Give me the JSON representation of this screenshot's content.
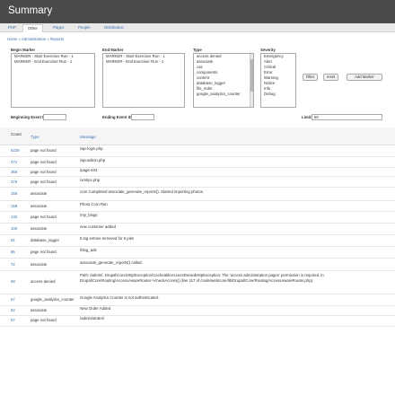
{
  "page": {
    "title": "Summary"
  },
  "tabs": [
    {
      "label": "PHP"
    },
    {
      "label": "Other"
    },
    {
      "label": "Pages"
    },
    {
      "label": "People"
    },
    {
      "label": "Distribution"
    }
  ],
  "breadcrumb": "Home » Administration » Reports",
  "filters": {
    "begin_marker": {
      "label": "Begin Marker",
      "options": [
        "MARKER - Start Exerciser Run - 1",
        "MARKER - End Exerciser Run - 1"
      ]
    },
    "end_marker": {
      "label": "End Marker",
      "options": [
        "MARKER - Start Exerciser Run - 1",
        "MARKER - End Exerciser Run - 1"
      ]
    },
    "type": {
      "label": "Type",
      "options": [
        "access denied",
        "associate",
        "cas",
        "components",
        "content",
        "database_logger",
        "file_mdm",
        "google_analytics_counter"
      ]
    },
    "severity": {
      "label": "Severity",
      "options": [
        "Emergency",
        "Alert",
        "Critical",
        "Error",
        "Warning",
        "Notice",
        "Info",
        "Debug"
      ]
    },
    "filter_button": "Filter",
    "reset_button": "reset",
    "add_marker_button": "Add Marker",
    "beginning_event_id": {
      "label": "Beginning Event ID",
      "value": ""
    },
    "ending_event_id": {
      "label": "Ending Event ID",
      "value": ""
    },
    "limit": {
      "label": "Limit:",
      "value": "50"
    }
  },
  "table": {
    "headers": {
      "count": "Count",
      "type": "Type",
      "message": "Message"
    },
    "rows": [
      {
        "count": "6229",
        "type": "page not found",
        "message": "/wp-login.php"
      },
      {
        "count": "371",
        "type": "page not found",
        "message": "/wp-admin.php"
      },
      {
        "count": "365",
        "type": "page not found",
        "message": "/page-404"
      },
      {
        "count": "279",
        "type": "page not found",
        "message": "/xmlrpc.php"
      },
      {
        "count": "158",
        "type": "associate",
        "message": "cron Completed associate_generate_reports(). Started importing photos."
      },
      {
        "count": "158",
        "type": "associate",
        "message": "Photo Cron Ran"
      },
      {
        "count": "133",
        "type": "page not found",
        "message": "/my_blogs"
      },
      {
        "count": "106",
        "type": "associate",
        "message": "new customer added"
      },
      {
        "count": "91",
        "type": "database_logger",
        "message": "0 log entries removed for 6 jobs"
      },
      {
        "count": "86",
        "type": "page not found",
        "message": "/blog_ads"
      },
      {
        "count": "72",
        "type": "associate",
        "message": "associate_generate_reports() called."
      },
      {
        "count": "68",
        "type": "access denied",
        "message": "Path: /admin/. Drupal\\Core\\Http\\Exception\\CacheableAccessDeniedHttpException: The 'access administration pages' permission is required. in Drupal\\Core\\Routing\\AccessAwareRouter->checkAccess() (line 117 of /code/web/core/lib/Drupal/Core/Routing/AccessAwareRouter.php)."
      },
      {
        "count": "67",
        "type": "google_analytics_counter",
        "message": "Google Analytics Counter is not authenticated."
      },
      {
        "count": "62",
        "type": "associate",
        "message": "New Order Added"
      },
      {
        "count": "57",
        "type": "page not found",
        "message": "/administrator/"
      }
    ]
  }
}
